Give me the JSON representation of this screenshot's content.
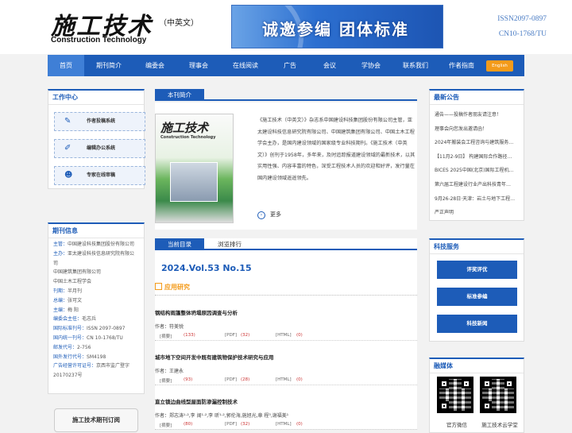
{
  "header": {
    "logo_cn": "施工技术",
    "logo_sub": "（中英文）",
    "logo_en": "Construction Technology",
    "banner_text": "诚邀参编 团体标准",
    "issn": "ISSN2097-0897",
    "cn": "CN10-1768/TU"
  },
  "nav": {
    "items": [
      "首页",
      "期刊简介",
      "编委会",
      "理事会",
      "在线阅读",
      "广告",
      "会议",
      "学协会",
      "联系我们",
      "作者指南"
    ],
    "english": "English"
  },
  "work_center": {
    "title": "工作中心",
    "buttons": [
      "作者投稿系统",
      "编辑办公系统",
      "专家在线审稿"
    ]
  },
  "journal_info": {
    "title": "期刊信息",
    "lines": [
      {
        "k": "主管：",
        "v": "中国建设科技集团股份有限公司"
      },
      {
        "k": "主办：",
        "v": "亚太建设科技信息研究院有限公司"
      },
      {
        "k": "",
        "v": "中国建筑集团有限公司"
      },
      {
        "k": "",
        "v": "中国土木工程学会"
      },
      {
        "k": "刊期：",
        "v": "半月刊"
      },
      {
        "k": "总编：",
        "v": "张可文"
      },
      {
        "k": "主编：",
        "v": "梅 阳"
      },
      {
        "k": "编委会主任：",
        "v": "毛志兵"
      },
      {
        "k": "国际标准刊号：",
        "v": "ISSN 2097-0897"
      },
      {
        "k": "国内统一刊号：",
        "v": "CN 10-1768/TU"
      },
      {
        "k": "邮发代号：",
        "v": "2-756"
      },
      {
        "k": "国外发行代号：",
        "v": "SM4198"
      },
      {
        "k": "广告经营许可证号：",
        "v": "京西市监广登字"
      },
      {
        "k": "",
        "v": "20170237号"
      }
    ],
    "subscribe": "施工技术期刊订阅"
  },
  "intro": {
    "tab": "本刊简介",
    "cover_title": "施工技术",
    "cover_en": "Construction Technology",
    "text": "《施工技术（中英文）》杂志系中国建设科技集团股份有限公司主管，亚太建设科技信息研究院有限公司、中国建筑集团有限公司、中国土木工程学会主办，是国内建设领域的国家级专业科技期刊。《施工技术（中英文）》创刊于1958年，多年来，及时追踪报道建设领域的最新技术，以其实用性强、内容丰富的特色，深受工程技术人员的欢迎和好评，发行量在国内建设领域遥遥领先。",
    "more": "更多"
  },
  "catalog": {
    "tabs": [
      "当前目录",
      "浏览排行"
    ],
    "volume": "2024.Vol.53 No.15",
    "section": "应用研究",
    "articles": [
      {
        "title": "钢结构雨篷整体坍塌原因调查与分析",
        "author": "作者：符美锐",
        "abs": "[摘要]",
        "abs_n": "(133)",
        "pdf": "[PDF]",
        "pdf_n": "(32)",
        "html": "[HTML]",
        "html_n": "(0)"
      },
      {
        "title": "城市地下空间开发中既有建筑物保护技术研究与应用",
        "author": "作者：王建永",
        "abs": "[摘要]",
        "abs_n": "(93)",
        "pdf": "[PDF]",
        "pdf_n": "(28)",
        "html": "[HTML]",
        "html_n": "(0)"
      },
      {
        "title": "直立锁边曲线型屋面防渗漏控制技术",
        "author": "作者：郑志涛¹·²,李 阔¹·²,李 昕¹·²,郭伦海,施旭光,章 程³,谢福美¹",
        "abs": "[摘要]",
        "abs_n": "(80)",
        "pdf": "[PDF]",
        "pdf_n": "(32)",
        "html": "[HTML]",
        "html_n": "(0)"
      }
    ]
  },
  "notices": {
    "title": "最新公告",
    "items": [
      "通告——投稿作者朋友请注意！",
      "理事会向您发出邀请函！",
      "2024年搬装会工程咨询与建筑服务…",
      "【11月2-9日】 构建国际合作路径…",
      "BICES 2025中国(北京)国际工程机…",
      "第六届工程建设行业产出科技青年…",
      "9月26-28日·天津：岩土与地下工程…",
      "严正声明"
    ]
  },
  "services": {
    "title": "科技服务",
    "buttons": [
      "评奖评优",
      "标准参编",
      "科技新闻"
    ]
  },
  "media": {
    "title": "融媒体",
    "captions": [
      "官方微信",
      "施工技术云学堂"
    ]
  },
  "colors": {
    "primary": "#1d5cb8",
    "accent": "#f49b1a"
  }
}
